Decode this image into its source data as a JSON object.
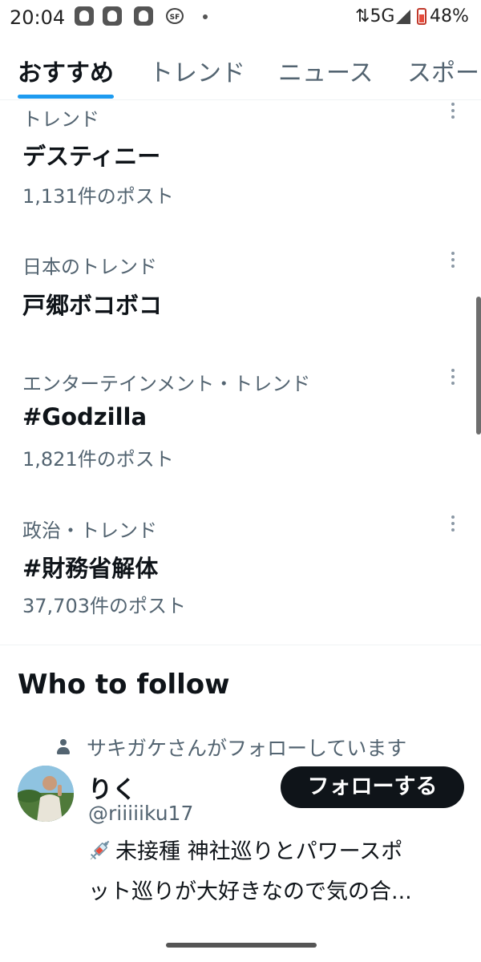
{
  "status_bar": {
    "time": "20:04",
    "network": "5G",
    "battery": "48%",
    "notif_icons": [
      "app-notification-icon",
      "app-notification-icon",
      "app-notification-icon",
      "sf-icon"
    ]
  },
  "tabs": [
    {
      "label": "おすすめ",
      "active": true
    },
    {
      "label": "トレンド",
      "active": false
    },
    {
      "label": "ニュース",
      "active": false
    },
    {
      "label": "スポーツ",
      "active": false
    }
  ],
  "trends": [
    {
      "category": "トレンド",
      "name": "デスティニー",
      "count": "1,131件のポスト"
    },
    {
      "category": "日本のトレンド",
      "name": "戸郷ボコボコ",
      "count": ""
    },
    {
      "category": "エンターテインメント・トレンド",
      "name": "#Godzilla",
      "count": "1,821件のポスト"
    },
    {
      "category": "政治・トレンド",
      "name": "#財務省解体",
      "count": "37,703件のポスト"
    }
  ],
  "who_to_follow": {
    "title": "Who to follow",
    "followed_by": "サキガケさんがフォローしています",
    "account": {
      "name": "りく",
      "handle": "@riiiiiku17",
      "follow_label": "フォローする",
      "bio_line1": "未接種 神社巡りとパワースポ",
      "bio_line2": "ット巡りが大好きなので気の合..."
    }
  },
  "colors": {
    "accent": "#1d9bf0",
    "text_primary": "#0f1419",
    "text_secondary": "#536471",
    "button_bg": "#0f1419"
  }
}
